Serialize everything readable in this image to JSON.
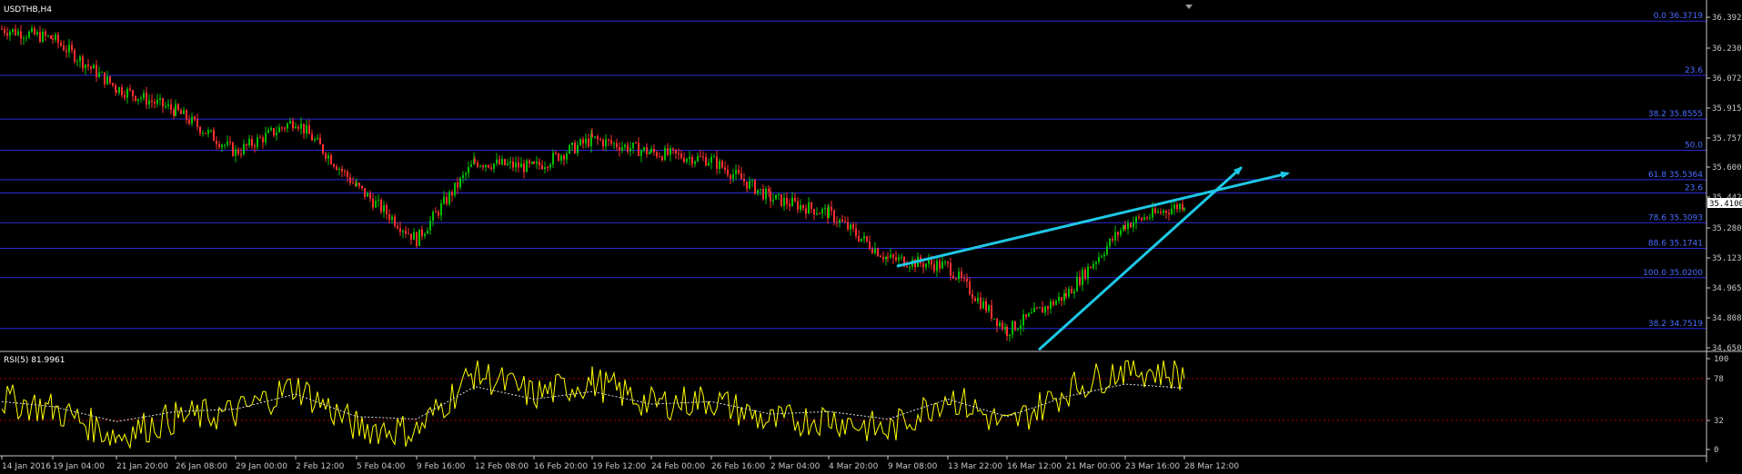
{
  "window": {
    "title": "USDTHB,H4"
  },
  "price_axis": {
    "ticks": [
      "36.3920",
      "36.2300",
      "36.0725",
      "35.9150",
      "35.7575",
      "35.6000",
      "35.4425",
      "35.2800",
      "35.1230",
      "34.9655",
      "34.8080",
      "34.6505"
    ],
    "current_price": "35.4100",
    "ylim": [
      34.6505,
      36.42
    ]
  },
  "fibonacci_levels": [
    {
      "label": "0.0 36.3719",
      "value": 36.3719
    },
    {
      "label": "23.6",
      "value": 36.086
    },
    {
      "label": "38.2 35.8555",
      "value": 35.8555
    },
    {
      "label": "50.0",
      "value": 35.691
    },
    {
      "label": "61.8 35.5364",
      "value": 35.5364
    },
    {
      "label": "23.6",
      "value": 35.466
    },
    {
      "label": "78.6 35.3093",
      "value": 35.3093
    },
    {
      "label": "88.6 35.1741",
      "value": 35.1741
    },
    {
      "label": "100.0 35.0200",
      "value": 35.02
    },
    {
      "label": "38.2 34.7519",
      "value": 34.7519
    }
  ],
  "rsi": {
    "title": "RSI(5) 81.9961",
    "ticks": [
      "100",
      "78",
      "32",
      "0"
    ],
    "levels": [
      78,
      32
    ]
  },
  "time_axis": {
    "labels": [
      "14 Jan 2016",
      "19 Jan 04:00",
      "21 Jan 20:00",
      "26 Jan 08:00",
      "29 Jan 00:00",
      "2 Feb 12:00",
      "5 Feb 04:00",
      "9 Feb 16:00",
      "12 Feb 08:00",
      "16 Feb 20:00",
      "19 Feb 12:00",
      "24 Feb 00:00",
      "26 Feb 16:00",
      "2 Mar 04:00",
      "4 Mar 20:00",
      "9 Mar 08:00",
      "13 Mar 22:00",
      "16 Mar 12:00",
      "21 Mar 00:00",
      "23 Mar 16:00",
      "28 Mar 12:00"
    ]
  },
  "chart_data": {
    "type": "candlestick",
    "symbol": "USDTHB",
    "timeframe": "H4",
    "anchors": [
      [
        "14 Jan 2016",
        36.33
      ],
      [
        "19 Jan 04:00",
        36.28
      ],
      [
        "21 Jan 20:00",
        36.02
      ],
      [
        "26 Jan 08:00",
        35.9
      ],
      [
        "29 Jan 00:00",
        35.68
      ],
      [
        "2 Feb 12:00",
        35.85
      ],
      [
        "5 Feb 04:00",
        35.5
      ],
      [
        "9 Feb 16:00",
        35.22
      ],
      [
        "12 Feb 08:00",
        35.63
      ],
      [
        "16 Feb 20:00",
        35.6
      ],
      [
        "19 Feb 12:00",
        35.75
      ],
      [
        "24 Feb 00:00",
        35.68
      ],
      [
        "26 Feb 16:00",
        35.64
      ],
      [
        "2 Mar 04:00",
        35.44
      ],
      [
        "4 Mar 20:00",
        35.36
      ],
      [
        "9 Mar 08:00",
        35.12
      ],
      [
        "13 Mar 22:00",
        35.08
      ],
      [
        "16 Mar 12:00",
        34.74
      ],
      [
        "21 Mar 00:00",
        34.93
      ],
      [
        "23 Mar 16:00",
        35.3
      ],
      [
        "28 Mar 12:00",
        35.41
      ]
    ],
    "rsi_anchors": [
      [
        "14 Jan 2016",
        55
      ],
      [
        "19 Jan 04:00",
        45
      ],
      [
        "21 Jan 20:00",
        15
      ],
      [
        "26 Jan 08:00",
        35
      ],
      [
        "29 Jan 00:00",
        40
      ],
      [
        "2 Feb 12:00",
        70
      ],
      [
        "5 Feb 04:00",
        25
      ],
      [
        "9 Feb 16:00",
        20
      ],
      [
        "12 Feb 08:00",
        85
      ],
      [
        "16 Feb 20:00",
        60
      ],
      [
        "19 Feb 12:00",
        75
      ],
      [
        "24 Feb 00:00",
        50
      ],
      [
        "26 Feb 16:00",
        55
      ],
      [
        "2 Mar 04:00",
        30
      ],
      [
        "4 Mar 20:00",
        35
      ],
      [
        "9 Mar 08:00",
        20
      ],
      [
        "13 Mar 22:00",
        60
      ],
      [
        "16 Mar 12:00",
        25
      ],
      [
        "21 Mar 00:00",
        65
      ],
      [
        "23 Mar 16:00",
        90
      ],
      [
        "28 Mar 12:00",
        82
      ]
    ],
    "trendlines": [
      {
        "name": "upper",
        "from": [
          "9 Mar 08:00",
          35.08
        ],
        "to": [
          "28 Mar 12:00",
          35.44
        ],
        "arrow_to": 35.57
      },
      {
        "name": "lower",
        "from": [
          "16 Mar 12:00",
          34.64
        ],
        "to": [
          "28 Mar 12:00",
          35.33
        ],
        "arrow_to": 35.6
      }
    ],
    "colors": {
      "background": "#000000",
      "bull": "#00c000",
      "bear": "#ff3030",
      "fib": "#2b2bd8",
      "fib_text": "#4a6cff",
      "trend": "#1ec8e6",
      "rsi": "#ffff00",
      "rsi_ma": "#dddddd",
      "rsi_levels": "#b00000",
      "axis": "#c8c8c8"
    }
  }
}
